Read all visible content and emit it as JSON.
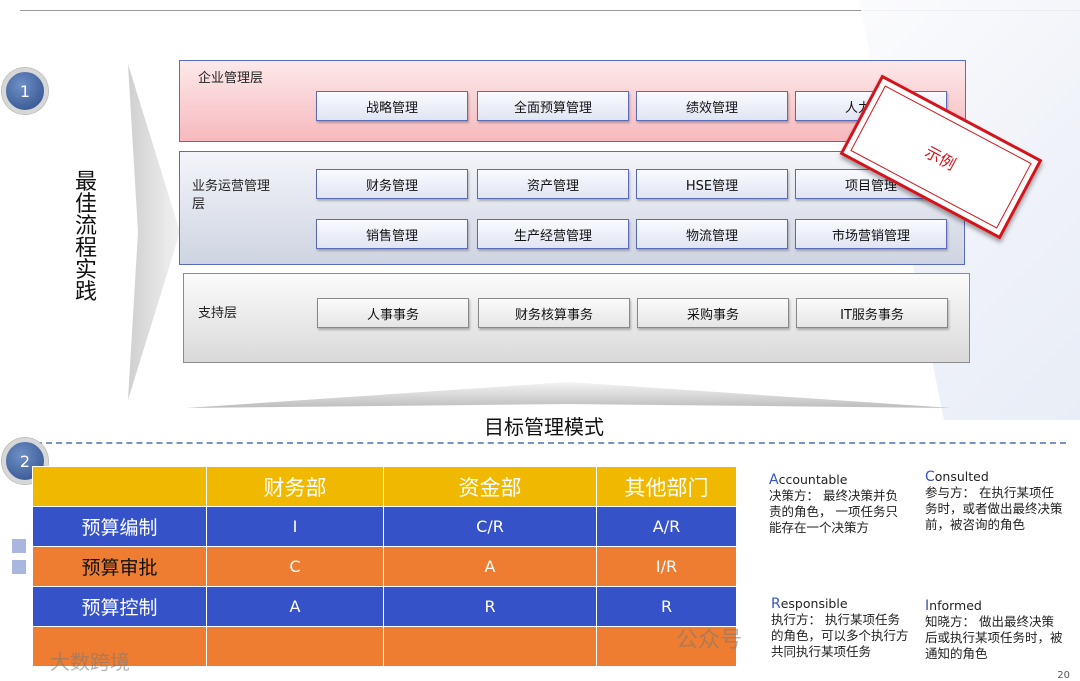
{
  "markers": {
    "one": "1",
    "two": "2"
  },
  "side_title": "最佳流程实践",
  "layers": {
    "enterprise": {
      "label": "企业管理层",
      "items": [
        "战略管理",
        "全面预算管理",
        "绩效管理",
        "人力资源"
      ]
    },
    "business": {
      "label": "业务运营管理层",
      "row1": [
        "财务管理",
        "资产管理",
        "HSE管理",
        "项目管理"
      ],
      "row2": [
        "销售管理",
        "生产经营管理",
        "物流管理",
        "市场营销管理"
      ]
    },
    "support": {
      "label": "支持层",
      "items": [
        "人事事务",
        "财务核算事务",
        "采购事务",
        "IT服务事务"
      ]
    }
  },
  "stamp": "示例",
  "mode_title": "目标管理模式",
  "raci": {
    "columns": [
      "",
      "财务部",
      "资金部",
      "其他部门"
    ],
    "rows": [
      {
        "name": "预算编制",
        "values": [
          "I",
          "C/R",
          "A/R"
        ]
      },
      {
        "name": "预算审批",
        "values": [
          "C",
          "A",
          "I/R"
        ]
      },
      {
        "name": "预算控制",
        "values": [
          "A",
          "R",
          "R"
        ]
      },
      {
        "name": "",
        "values": [
          "",
          "",
          ""
        ]
      }
    ]
  },
  "legend": {
    "accountable": {
      "first": "A",
      "rest": "ccountable",
      "desc": "决策方： 最终决策并负责的角色， 一项任务只能存在一个决策方"
    },
    "consulted": {
      "first": "C",
      "rest": "onsulted",
      "desc": "参与方： 在执行某项任务时，或者做出最终决策前，被咨询的角色"
    },
    "responsible": {
      "first": "R",
      "rest": "esponsible",
      "desc": "执行方： 执行某项任务的角色，可以多个执行方共同执行某项任务"
    },
    "informed": {
      "first": "I",
      "rest": "nformed",
      "desc": "知晓方： 做出最终决策后或执行某项任务时，被通知的角色"
    }
  },
  "watermarks": {
    "left": "大数跨境",
    "center": "公众号"
  },
  "page_number": "20",
  "colors": {
    "accent_blue": "#3552c8",
    "orange": "#ee7d31",
    "gold": "#f1b800",
    "stamp_red": "#d4141c"
  }
}
